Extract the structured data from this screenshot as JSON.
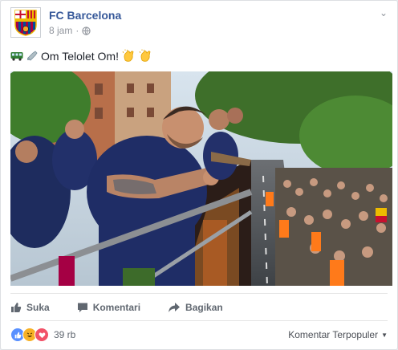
{
  "post": {
    "page_name": "FC Barcelona",
    "time": "8 jam",
    "audience_icon": "globe-icon",
    "text": "Om Telolet Om!",
    "text_emojis": [
      "bus-icon",
      "horn-icon"
    ],
    "trailing_emojis": [
      "clapping-hands-icon",
      "clapping-hands-icon"
    ]
  },
  "actions": {
    "like_label": "Suka",
    "comment_label": "Komentari",
    "share_label": "Bagikan"
  },
  "footer": {
    "reaction_icons": [
      "like-reaction-icon",
      "haha-reaction-icon",
      "love-reaction-icon"
    ],
    "reaction_count": "39 rb",
    "sort_label": "Komentar Terpopuler"
  },
  "colors": {
    "link": "#365899",
    "like_blue": "#5890ff",
    "love_red": "#f25268",
    "haha_yellow": "#f7b125"
  }
}
